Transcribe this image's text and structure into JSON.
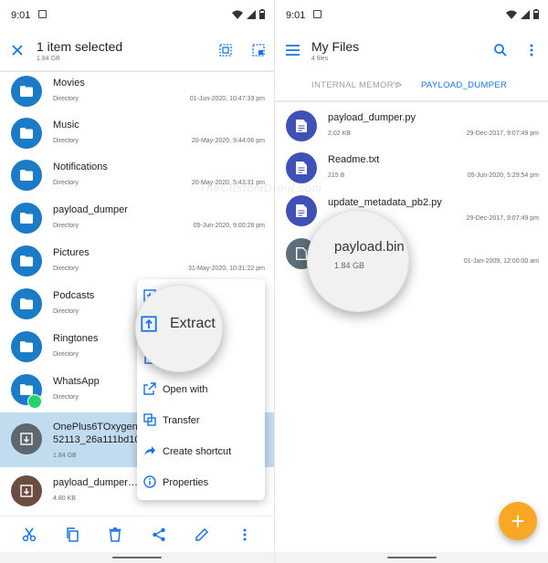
{
  "status": {
    "time": "9:01"
  },
  "left_appbar": {
    "title": "1 item selected",
    "subtitle": "1.84 GB"
  },
  "left_list": [
    {
      "name": "Movies",
      "sub": "Directory",
      "date": "01-Jun-2020, 10:47:33 pm"
    },
    {
      "name": "Music",
      "sub": "Directory",
      "date": "20-May-2020, 9:44:06 pm"
    },
    {
      "name": "Notifications",
      "sub": "Directory",
      "date": "20-May-2020, 5:43:31 pm"
    },
    {
      "name": "payload_dumper",
      "sub": "Directory",
      "date": "05-Jun-2020, 9:00:28 pm"
    },
    {
      "name": "Pictures",
      "sub": "Directory",
      "date": "31-May-2020, 10:31:22 pm"
    },
    {
      "name": "Podcasts",
      "sub": "Directory",
      "date": ""
    },
    {
      "name": "Ringtones",
      "sub": "Directory",
      "date": ""
    },
    {
      "name": "WhatsApp",
      "sub": "Directory",
      "date": ""
    },
    {
      "name": "OnePlus6TOxygen…52113_26a111bd10…",
      "sub": "1.84 GB",
      "date": ""
    },
    {
      "name": "payload_dumper…",
      "sub": "4.80 KB",
      "date": ""
    }
  ],
  "context_menu": {
    "items": [
      {
        "label": ""
      },
      {
        "label": ""
      },
      {
        "label": ""
      },
      {
        "label": "Open with"
      },
      {
        "label": "Transfer"
      },
      {
        "label": "Create shortcut"
      },
      {
        "label": "Properties"
      }
    ],
    "magnified_label": "Extract"
  },
  "right_appbar": {
    "title": "My Files",
    "subtitle": "4 files"
  },
  "breadcrumb": {
    "first": "INTERNAL MEMORY",
    "separator": ">",
    "current": "PAYLOAD_DUMPER"
  },
  "right_list": [
    {
      "name": "payload_dumper.py",
      "sub": "2.02 KB",
      "date": "29-Dec-2017, 9:07:49 pm"
    },
    {
      "name": "Readme.txt",
      "sub": "215 B",
      "date": "05-Jun-2020, 5:29:54 pm"
    },
    {
      "name": "update_metadata_pb2.py",
      "sub": "",
      "date": "29-Dec-2017, 9:07:49 pm"
    },
    {
      "name": "",
      "sub": "",
      "date": "01-Jan-2009, 12:00:00 am"
    }
  ],
  "file_magnifier": {
    "name": "payload.bin",
    "size": "1.84 GB"
  },
  "watermark": "TheCustomDroid.com",
  "fab": {
    "label": "+"
  },
  "colors": {
    "folder_blue": "#1b7bc6",
    "doc_indigo": "#3f51b5",
    "bin_gray": "#5d6f7a",
    "archive_gray": "#5c6770",
    "archive_brown": "#6d4c41",
    "accent": "#1a73e8",
    "fab": "#f9a825",
    "selected_row": "#c2dcef",
    "whatsapp_green": "#25d366"
  }
}
